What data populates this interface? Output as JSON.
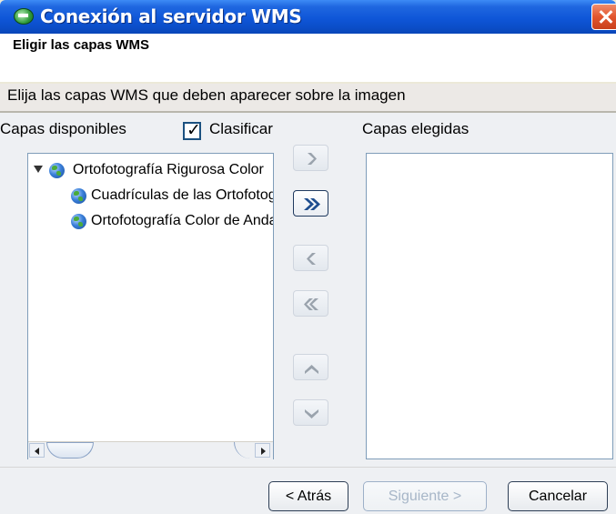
{
  "window": {
    "title": "Conexión al servidor WMS",
    "title_icon": "junta-andalucia-icon",
    "close_icon": "close-icon"
  },
  "step": {
    "title": "Eligir las capas WMS",
    "description": "Elija las capas WMS que deben aparecer sobre la imagen"
  },
  "available": {
    "label": "Capas disponibles",
    "sort_checkbox_label": "Clasificar",
    "sort_checked": true,
    "tree": [
      {
        "label": "Ortofotografía Rigurosa Color",
        "level": 0,
        "expanded": true,
        "icon": "globe-icon"
      },
      {
        "label": "Cuadrículas de las Ortofotografías",
        "level": 1,
        "icon": "globe-icon"
      },
      {
        "label": "Ortofotografía Color de Andalucía",
        "level": 1,
        "icon": "globe-icon"
      }
    ]
  },
  "chosen": {
    "label": "Capas elegidas",
    "items": []
  },
  "move_buttons": [
    {
      "name": "add-one-button",
      "icon": "chevron-right-icon",
      "enabled": false
    },
    {
      "name": "add-all-button",
      "icon": "double-chevron-right-icon",
      "enabled": true
    },
    {
      "name": "remove-one-button",
      "icon": "chevron-left-icon",
      "enabled": false
    },
    {
      "name": "remove-all-button",
      "icon": "double-chevron-left-icon",
      "enabled": false
    },
    {
      "name": "move-up-button",
      "icon": "chevron-up-icon",
      "enabled": false
    },
    {
      "name": "move-down-button",
      "icon": "chevron-down-icon",
      "enabled": false
    }
  ],
  "footer": {
    "back_label": "< Atrás",
    "next_label": "Siguiente >",
    "next_enabled": false,
    "cancel_label": "Cancelar"
  },
  "colors": {
    "titlebar": "#0f56d8",
    "close_button": "#e2552e",
    "active_arrow": "#1f4e8f",
    "disabled_arrow": "#9aa3ad"
  }
}
